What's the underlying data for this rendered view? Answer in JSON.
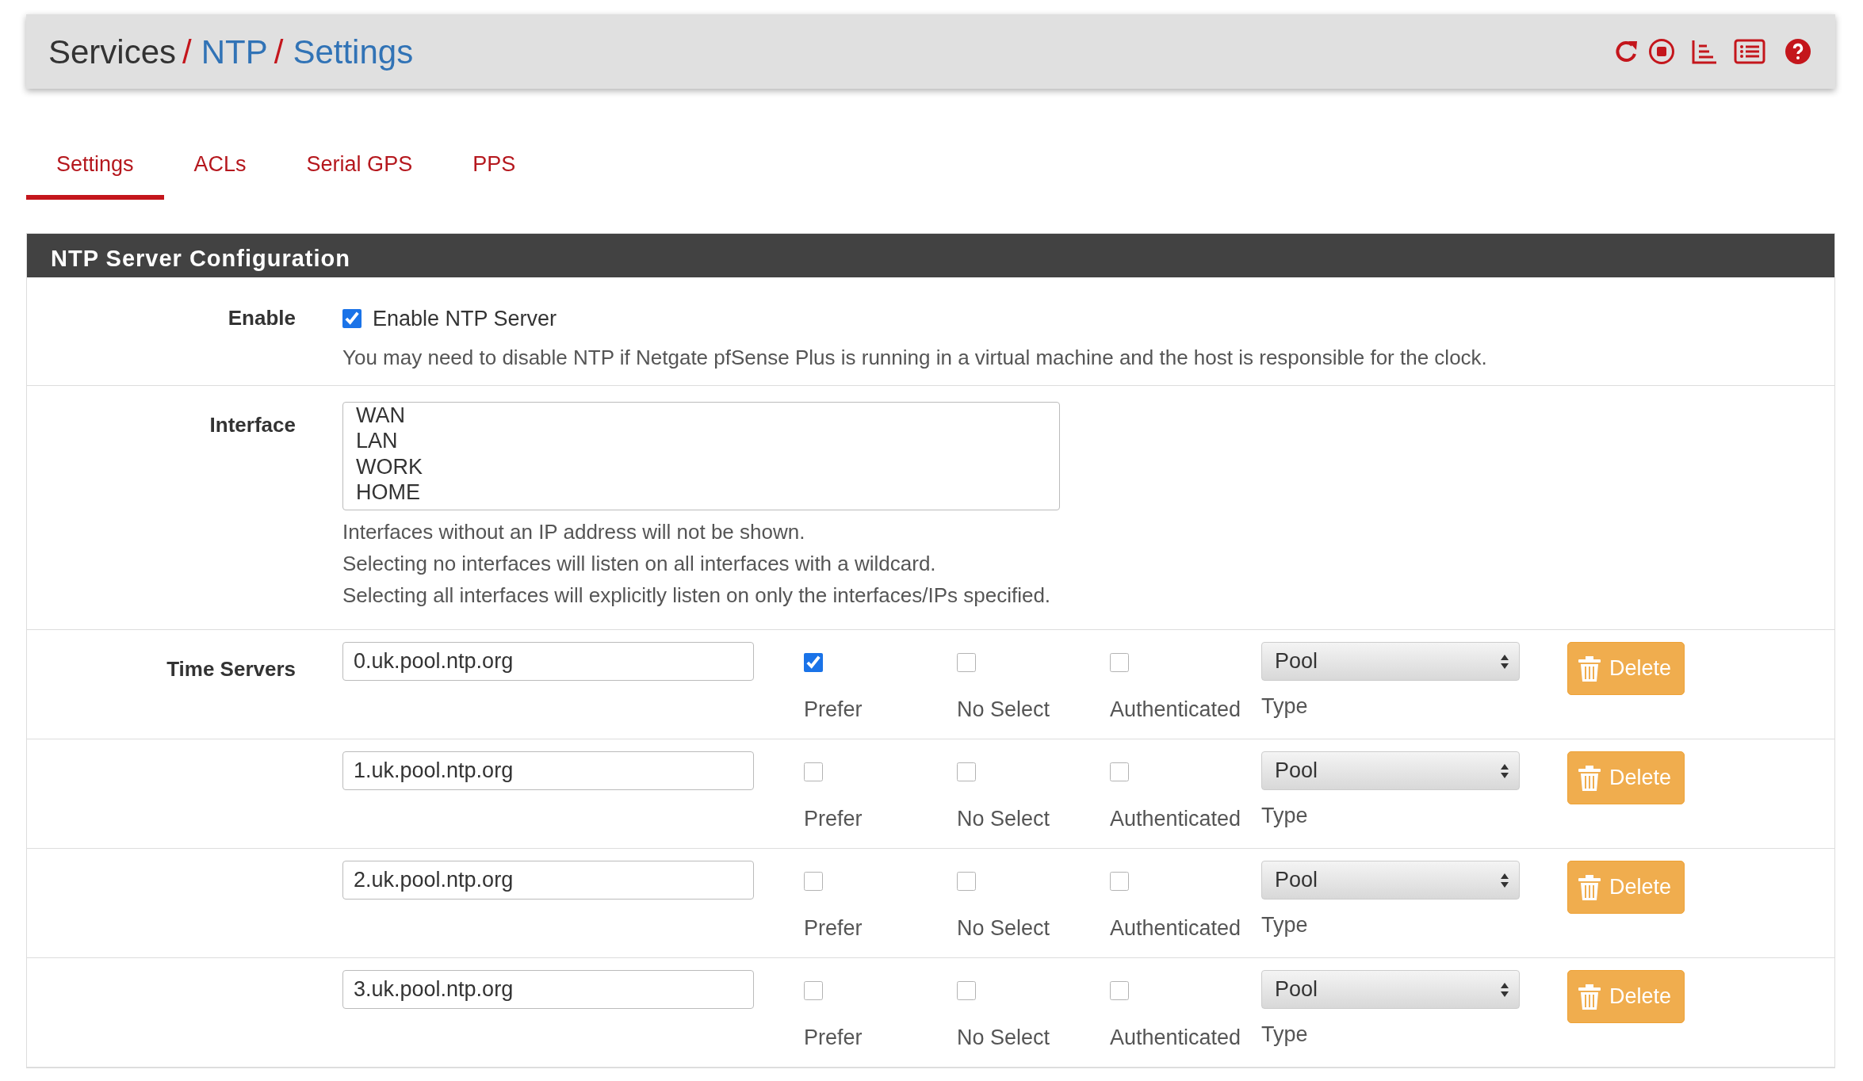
{
  "breadcrumb": [
    {
      "text": "Services",
      "kind": "plain",
      "separator": "/"
    },
    {
      "text": "NTP",
      "kind": "link",
      "separator": "/"
    },
    {
      "text": "Settings",
      "kind": "link"
    }
  ],
  "tabs": [
    {
      "label": "Settings",
      "selected": true
    },
    {
      "label": "ACLs",
      "selected": false
    },
    {
      "label": "Serial GPS",
      "selected": false
    },
    {
      "label": "PPS",
      "selected": false
    }
  ],
  "panel": {
    "title": "NTP Server Configuration",
    "enable": {
      "label": "Enable",
      "checkbox_label": "Enable NTP Server",
      "checked": true,
      "help": "You may need to disable NTP if Netgate pfSense Plus is running in a virtual machine and the host is responsible for the clock."
    },
    "interface": {
      "label": "Interface",
      "options": [
        {
          "text": "WAN",
          "selected": false
        },
        {
          "text": "LAN",
          "selected": false
        },
        {
          "text": "WORK",
          "selected": false
        },
        {
          "text": "HOME",
          "selected": false
        }
      ],
      "help": [
        "Interfaces without an IP address will not be shown.",
        "Selecting no interfaces will listen on all interfaces with a wildcard.",
        "Selecting all interfaces will explicitly listen on only the interfaces/IPs specified."
      ]
    },
    "time_servers": {
      "label": "Time Servers",
      "rows": [
        {
          "host": "0.uk.pool.ntp.org",
          "options": [
            {
              "label": "Prefer",
              "checked": true
            },
            {
              "label": "No Select",
              "checked": false
            },
            {
              "label": "Authenticated",
              "checked": false
            }
          ],
          "type": "Pool",
          "type_label": "Type",
          "delete": "Delete"
        },
        {
          "host": "1.uk.pool.ntp.org",
          "options": [
            {
              "label": "Prefer",
              "checked": false
            },
            {
              "label": "No Select",
              "checked": false
            },
            {
              "label": "Authenticated",
              "checked": false
            }
          ],
          "type": "Pool",
          "type_label": "Type",
          "delete": "Delete"
        },
        {
          "host": "2.uk.pool.ntp.org",
          "options": [
            {
              "label": "Prefer",
              "checked": false
            },
            {
              "label": "No Select",
              "checked": false
            },
            {
              "label": "Authenticated",
              "checked": false
            }
          ],
          "type": "Pool",
          "type_label": "Type",
          "delete": "Delete"
        },
        {
          "host": "3.uk.pool.ntp.org",
          "options": [
            {
              "label": "Prefer",
              "checked": false
            },
            {
              "label": "No Select",
              "checked": false
            },
            {
              "label": "Authenticated",
              "checked": false
            }
          ],
          "type": "Pool",
          "type_label": "Type",
          "delete": "Delete"
        }
      ]
    }
  }
}
